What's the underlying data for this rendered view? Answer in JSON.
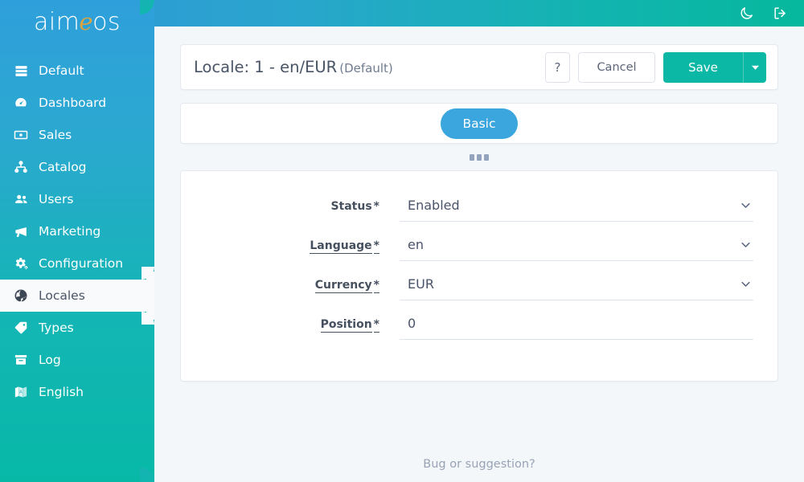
{
  "brand": {
    "part1": "aim",
    "accent": "e",
    "part2": "os",
    "accent_color": "#d9a441"
  },
  "topbar": {
    "dark_mode_icon": "moon-icon",
    "logout_icon": "logout-icon",
    "gradient_from": "#2f96d8",
    "gradient_to": "#06b89d"
  },
  "sidebar": {
    "gradient_from": "#2f9fdb",
    "gradient_to": "#07b8a7",
    "active_bg": "#f8fafc",
    "items": [
      {
        "label": "Default",
        "icon": "server-icon",
        "active": false
      },
      {
        "label": "Dashboard",
        "icon": "dashboard-icon",
        "active": false
      },
      {
        "label": "Sales",
        "icon": "money-bill-icon",
        "active": false
      },
      {
        "label": "Catalog",
        "icon": "sitemap-icon",
        "active": false
      },
      {
        "label": "Users",
        "icon": "users-icon",
        "active": false
      },
      {
        "label": "Marketing",
        "icon": "bullhorn-icon",
        "active": false
      },
      {
        "label": "Configuration",
        "icon": "cogs-icon",
        "active": false
      },
      {
        "label": "Locales",
        "icon": "globe-icon",
        "active": true
      },
      {
        "label": "Types",
        "icon": "tag-icon",
        "active": false
      },
      {
        "label": "Log",
        "icon": "archive-icon",
        "active": false
      },
      {
        "label": "English",
        "icon": "language-icon",
        "active": false
      }
    ]
  },
  "header": {
    "title": "Locale: 1 - en/EUR",
    "subtitle": "(Default)",
    "help_label": "?",
    "cancel_label": "Cancel",
    "save_label": "Save",
    "save_caret_icon": "caret-down-icon",
    "save_color": "#0bb7a5"
  },
  "tabs": [
    {
      "label": "Basic",
      "active": true,
      "color": "#3ba5de"
    }
  ],
  "handle": {
    "icon": "drag-handle-icon",
    "dots": 3
  },
  "form": {
    "fields": [
      {
        "label": "Status",
        "required_marker": "*",
        "underlined": false,
        "value": "Enabled",
        "type": "select",
        "caret_icon": "chevron-down-icon"
      },
      {
        "label": "Language",
        "required_marker": "*",
        "underlined": true,
        "value": "en",
        "type": "select",
        "caret_icon": "chevron-down-icon"
      },
      {
        "label": "Currency",
        "required_marker": "*",
        "underlined": true,
        "value": "EUR",
        "type": "select",
        "caret_icon": "chevron-down-icon"
      },
      {
        "label": "Position",
        "required_marker": "*",
        "underlined": true,
        "value": "0",
        "type": "text",
        "caret_icon": null
      }
    ]
  },
  "footer": {
    "link_label": "Bug or suggestion?"
  }
}
